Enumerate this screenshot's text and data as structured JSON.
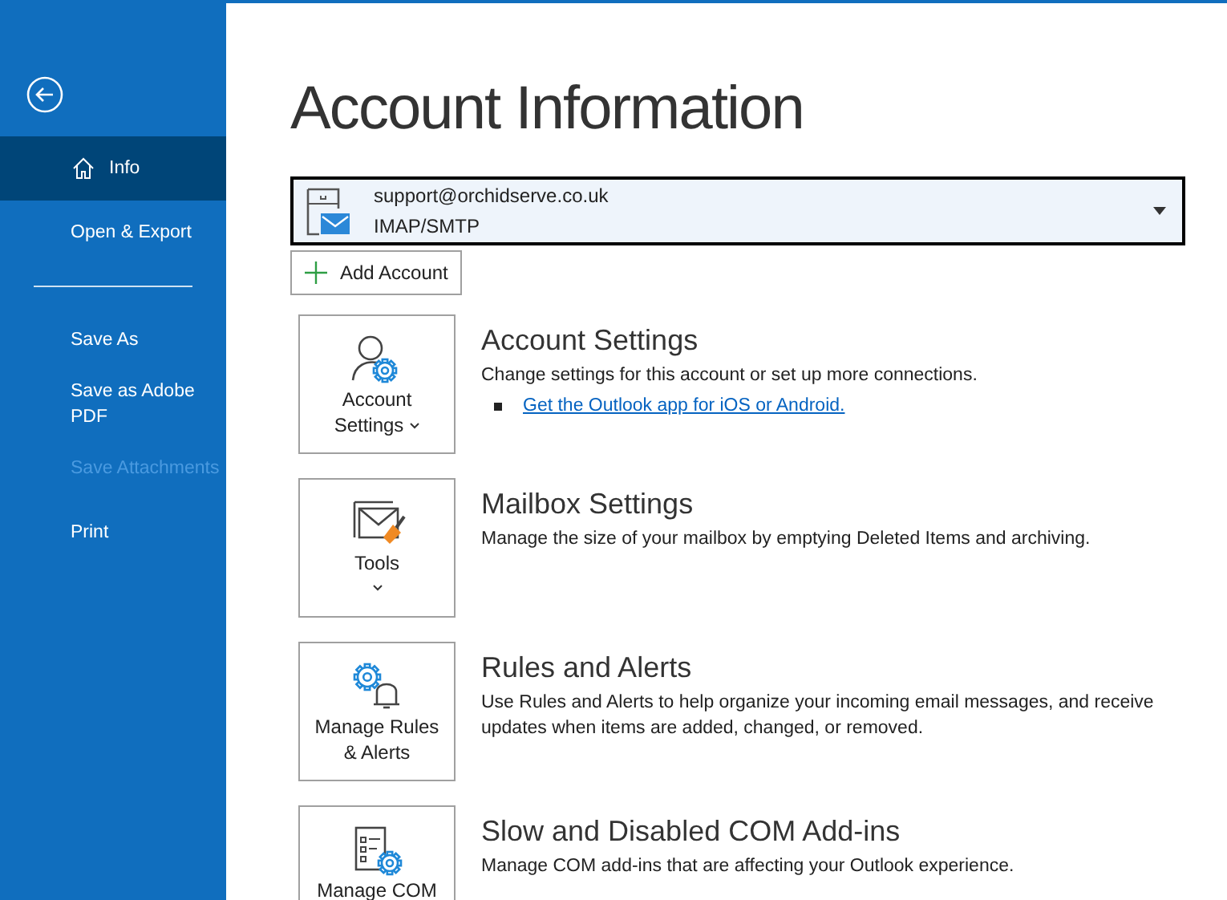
{
  "sidebar": {
    "items": [
      {
        "label": "Info",
        "selected": true,
        "disabled": false,
        "kind": "item"
      },
      {
        "label": "Open & Export",
        "selected": false,
        "disabled": false,
        "kind": "item"
      },
      {
        "kind": "divider"
      },
      {
        "label": "Save As",
        "selected": false,
        "disabled": false,
        "kind": "item"
      },
      {
        "label": "Save as Adobe PDF",
        "selected": false,
        "disabled": false,
        "kind": "item"
      },
      {
        "label": "Save Attachments",
        "selected": false,
        "disabled": true,
        "kind": "item"
      },
      {
        "label": "Print",
        "selected": false,
        "disabled": false,
        "kind": "item"
      }
    ]
  },
  "title": "Account Information",
  "account": {
    "email": "support@orchidserve.co.uk",
    "type": "IMAP/SMTP"
  },
  "add_account": "Add Account",
  "sections": [
    {
      "kind": "settings",
      "tile": [
        "Account",
        "Settings"
      ],
      "heading": "Account Settings",
      "description": "Change settings for this account or set up more connections.",
      "links": [
        "Get the Outlook app for iOS or Android."
      ]
    },
    {
      "kind": "tools",
      "tile": [
        "Tools"
      ],
      "heading": "Mailbox Settings",
      "description": "Manage the size of your mailbox by emptying Deleted Items and archiving."
    },
    {
      "kind": "rules",
      "tile": [
        "Manage Rules",
        "& Alerts"
      ],
      "heading": "Rules and Alerts",
      "description": "Use Rules and Alerts to help organize your incoming email messages, and receive updates when items are added, changed, or removed."
    },
    {
      "kind": "addins",
      "tile": [
        "Manage COM"
      ],
      "heading": "Slow and Disabled COM Add-ins",
      "description": "Manage COM add-ins that are affecting your Outlook experience."
    }
  ]
}
